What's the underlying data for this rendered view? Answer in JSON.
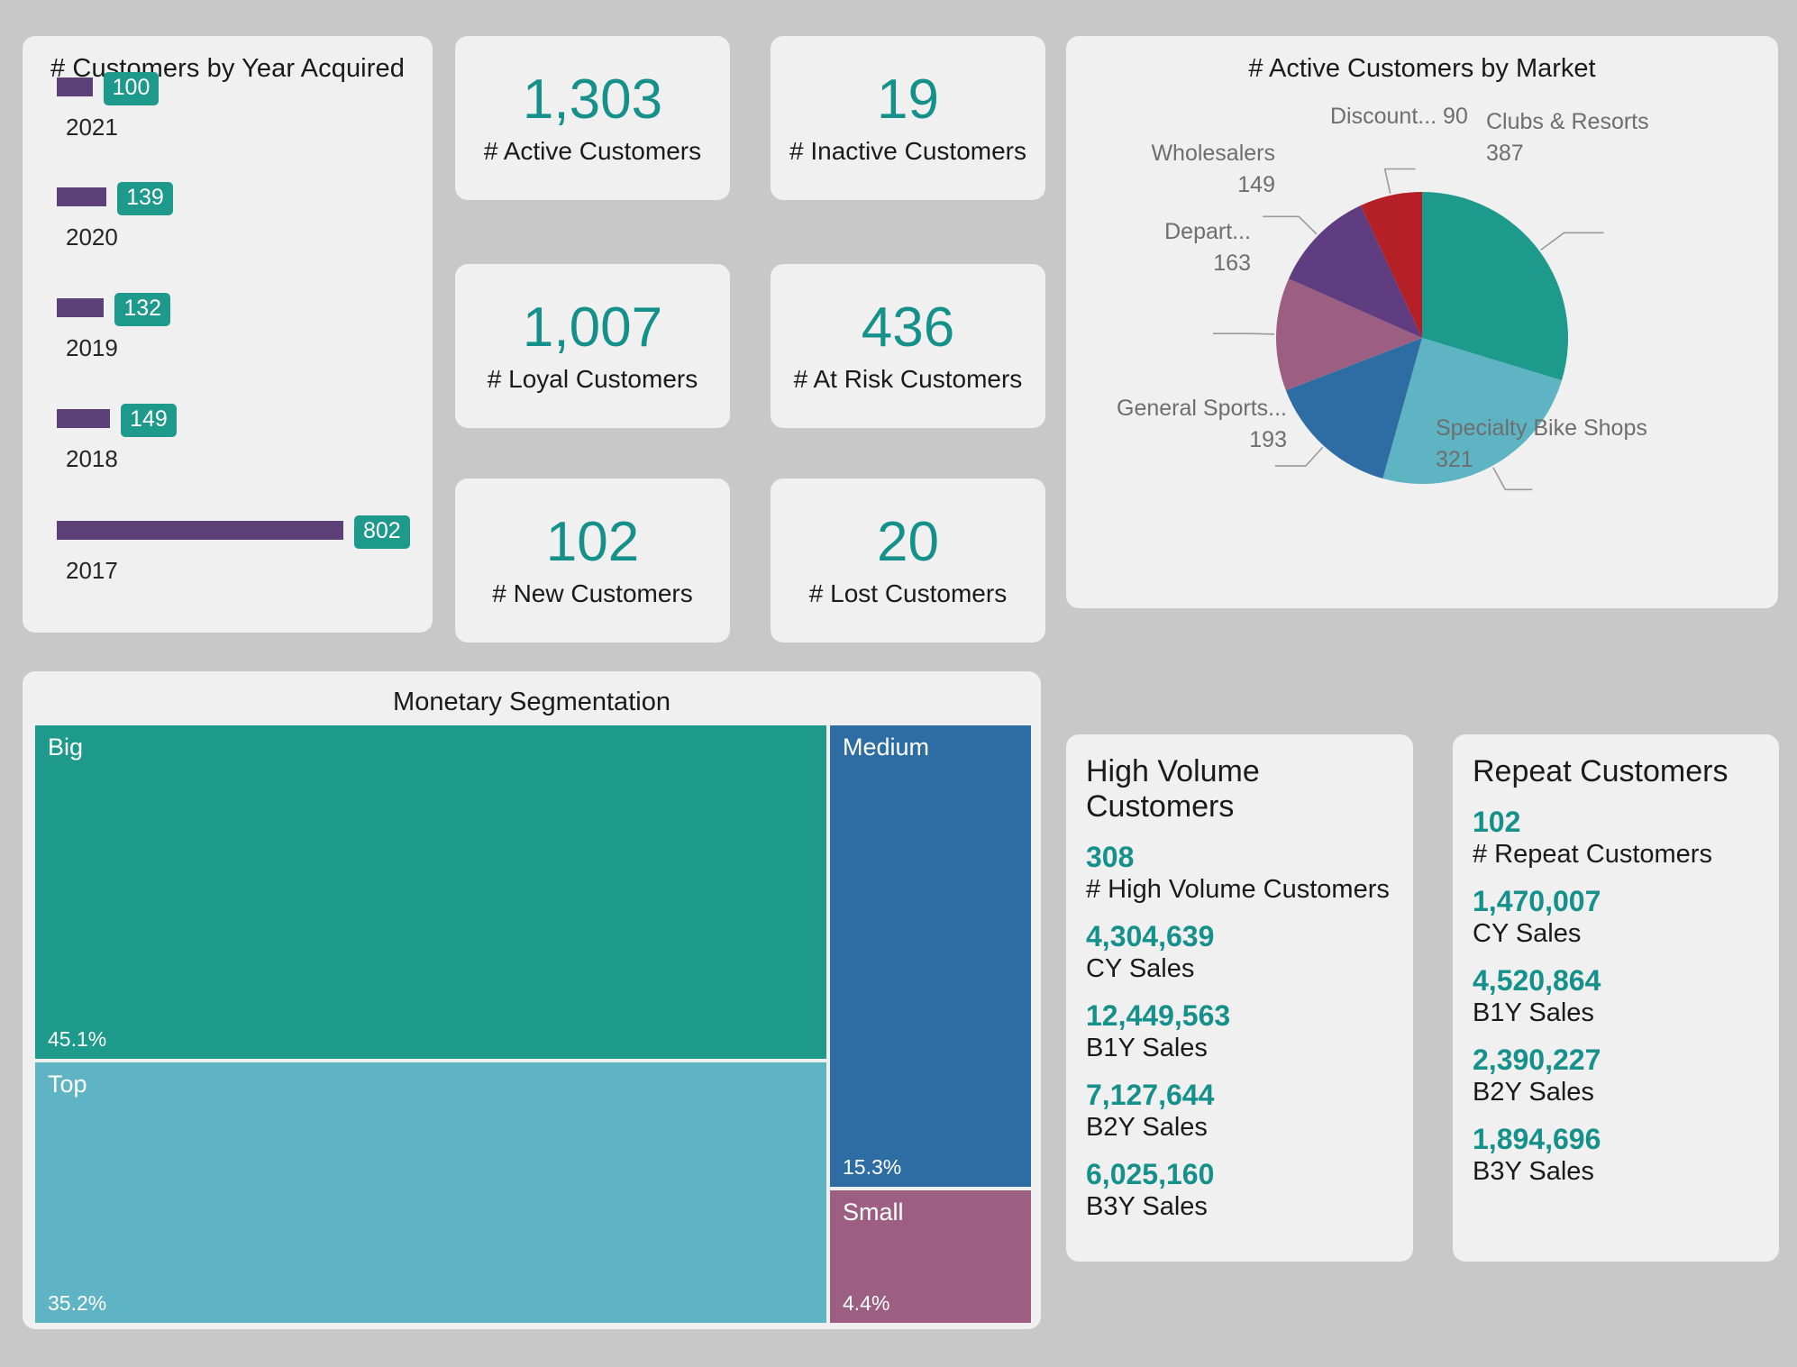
{
  "bar_panel": {
    "title": "# Customers by Year Acquired"
  },
  "kpis": [
    {
      "value": "1,303",
      "label": "# Active Customers"
    },
    {
      "value": "19",
      "label": "# Inactive Customers"
    },
    {
      "value": "1,007",
      "label": "# Loyal Customers"
    },
    {
      "value": "436",
      "label": "# At Risk Customers"
    },
    {
      "value": "102",
      "label": "# New Customers"
    },
    {
      "value": "20",
      "label": "# Lost Customers"
    }
  ],
  "pie_panel": {
    "title": "# Active Customers by Market"
  },
  "treemap_panel": {
    "title": "Monetary Segmentation"
  },
  "detail_cards": [
    {
      "title": "High Volume Customers",
      "metrics": [
        {
          "value": "308",
          "label": "# High Volume Customers"
        },
        {
          "value": "4,304,639",
          "label": "CY Sales"
        },
        {
          "value": "12,449,563",
          "label": "B1Y Sales"
        },
        {
          "value": "7,127,644",
          "label": "B2Y Sales"
        },
        {
          "value": "6,025,160",
          "label": "B3Y Sales"
        }
      ]
    },
    {
      "title": "Repeat Customers",
      "metrics": [
        {
          "value": "102",
          "label": "# Repeat Customers"
        },
        {
          "value": "1,470,007",
          "label": "CY Sales"
        },
        {
          "value": "4,520,864",
          "label": "B1Y Sales"
        },
        {
          "value": "2,390,227",
          "label": "B2Y Sales"
        },
        {
          "value": "1,894,696",
          "label": "B3Y Sales"
        }
      ]
    }
  ],
  "colors": {
    "accent_teal": "#16908a",
    "bar_purple": "#5c4077",
    "badge_teal": "#1d9a8c",
    "page_bg": "#c8c8c8",
    "card_bg": "#f0f0f0",
    "label_gray": "#6e6e6e"
  },
  "chart_data": [
    {
      "type": "bar",
      "title": "# Customers by Year Acquired",
      "orientation": "horizontal",
      "categories": [
        "2021",
        "2020",
        "2019",
        "2018",
        "2017"
      ],
      "values": [
        100,
        139,
        132,
        149,
        802
      ],
      "xlabel": "",
      "ylabel": "",
      "xlim": [
        0,
        802
      ],
      "grid": false,
      "data_labels": true,
      "bar_color": "#5c4077",
      "label_badge_color": "#1d9a8c",
      "note": "2021 data label is clipped by the top edge of the card"
    },
    {
      "type": "pie",
      "title": "# Active Customers by Market",
      "labels": [
        "Clubs & Resorts",
        "Specialty Bike Shops",
        "General Sports...",
        "Depart...",
        "Wholesalers",
        "Discount..."
      ],
      "values": [
        387,
        321,
        193,
        163,
        149,
        90
      ],
      "colors": [
        "#1d9a8c",
        "#5fb4c4",
        "#2e6da4",
        "#9c5f82",
        "#5f3d80",
        "#b42025"
      ],
      "legend": "outside-callout-labels",
      "total": 1303
    },
    {
      "type": "treemap",
      "title": "Monetary Segmentation",
      "labels": [
        "Big",
        "Top",
        "Medium",
        "Small"
      ],
      "values": [
        45.1,
        35.2,
        15.3,
        4.4
      ],
      "value_suffix": "%",
      "colors": [
        "#1d9a8c",
        "#5fb4c4",
        "#2e6da4",
        "#9c5f82"
      ]
    }
  ]
}
